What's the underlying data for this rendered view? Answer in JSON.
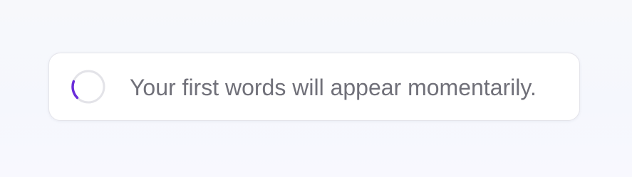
{
  "loading": {
    "message": "Your first words will appear momentarily.",
    "spinner_icon": "loading-spinner-icon",
    "spinner_progress": 0.18
  },
  "colors": {
    "spinner_track": "#e3e3e8",
    "spinner_arc": "#6a2cd9",
    "text": "#707079",
    "card_background": "#ffffff",
    "page_background": "#f6f7fc"
  }
}
